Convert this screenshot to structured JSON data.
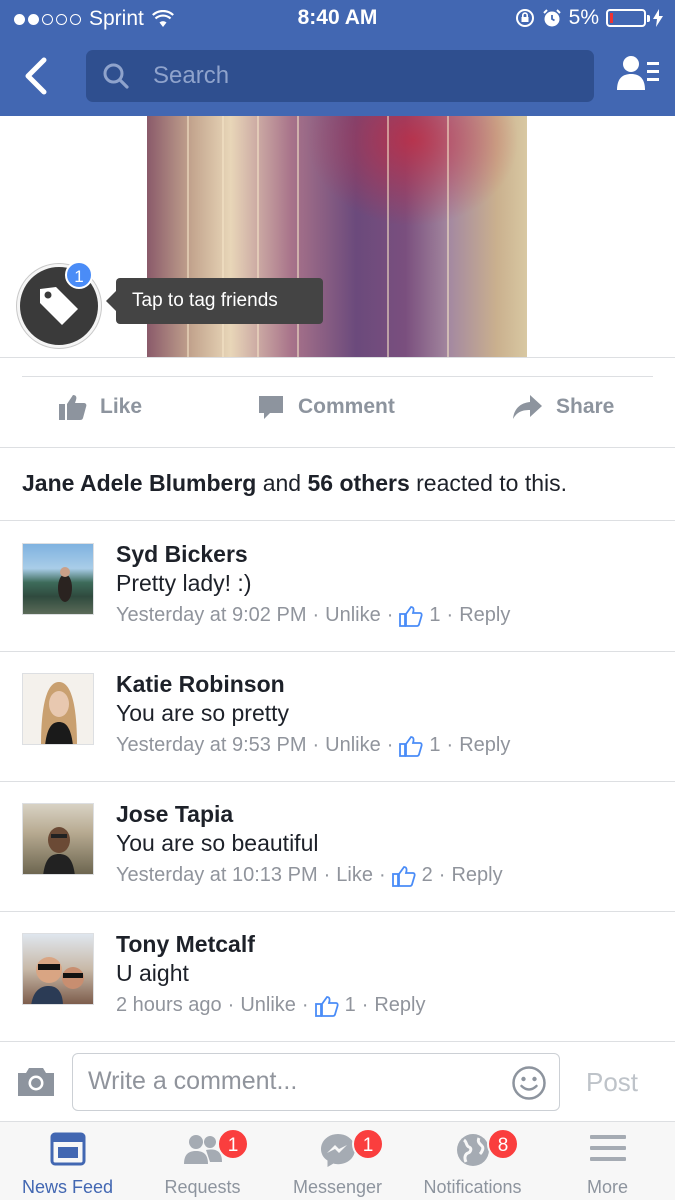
{
  "status_bar": {
    "carrier": "Sprint",
    "time": "8:40 AM",
    "battery": "5%",
    "battery_level": 0.05
  },
  "nav": {
    "search_placeholder": "Search"
  },
  "photo": {
    "tag_badge": "1",
    "tooltip": "Tap to tag friends"
  },
  "actions": {
    "like": "Like",
    "comment": "Comment",
    "share": "Share"
  },
  "reactions": {
    "name": "Jane Adele Blumberg",
    "and": "and",
    "others": "56 others",
    "suffix": "reacted to this."
  },
  "comments": [
    {
      "name": "Syd Bickers",
      "text": "Pretty lady! :)",
      "time": "Yesterday at 9:02 PM",
      "action": "Unlike",
      "likes": "1",
      "reply": "Reply"
    },
    {
      "name": "Katie Robinson",
      "text": "You are so pretty",
      "time": "Yesterday at 9:53 PM",
      "action": "Unlike",
      "likes": "1",
      "reply": "Reply"
    },
    {
      "name": "Jose Tapia",
      "text": "You are so beautiful",
      "time": "Yesterday at 10:13 PM",
      "action": "Like",
      "likes": "2",
      "reply": "Reply"
    },
    {
      "name": "Tony Metcalf",
      "text": "U aight",
      "time": "2 hours ago",
      "action": "Unlike",
      "likes": "1",
      "reply": "Reply"
    }
  ],
  "composer": {
    "placeholder": "Write a comment...",
    "post": "Post"
  },
  "tabs": [
    {
      "label": "News Feed",
      "icon": "news-feed-icon",
      "badge": ""
    },
    {
      "label": "Requests",
      "icon": "friend-requests-icon",
      "badge": "1"
    },
    {
      "label": "Messenger",
      "icon": "messenger-icon",
      "badge": "1"
    },
    {
      "label": "Notifications",
      "icon": "globe-icon",
      "badge": "8"
    },
    {
      "label": "More",
      "icon": "menu-icon",
      "badge": ""
    }
  ],
  "colors": {
    "brand": "#4267b2",
    "badge": "#fa3e3e",
    "tag_badge": "#4a8cf7",
    "like_blue": "#4a8cf7"
  }
}
